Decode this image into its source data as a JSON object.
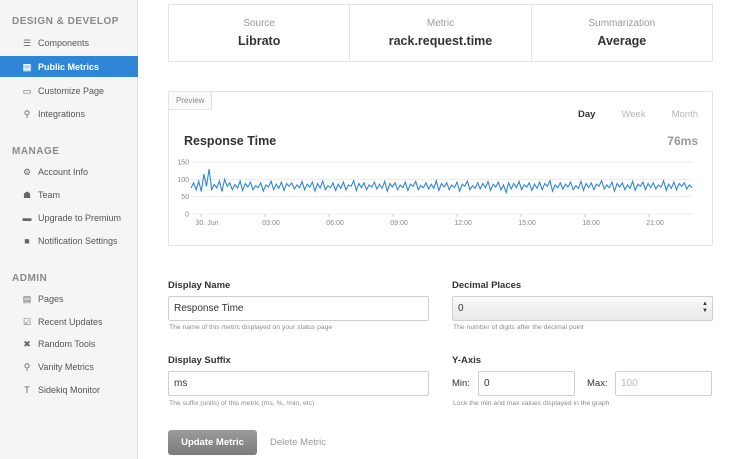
{
  "sidebar": {
    "sections": [
      {
        "title": "DESIGN & DEVELOP",
        "items": [
          {
            "label": "Components",
            "icon": "list-icon",
            "glyph": "☰"
          },
          {
            "label": "Public Metrics",
            "icon": "chart-icon",
            "glyph": "▤",
            "active": true
          },
          {
            "label": "Customize Page",
            "icon": "image-icon",
            "glyph": "▭"
          },
          {
            "label": "Integrations",
            "icon": "plug-icon",
            "glyph": "⚲"
          }
        ]
      },
      {
        "title": "MANAGE",
        "items": [
          {
            "label": "Account Info",
            "icon": "gear-icon",
            "glyph": "⚙"
          },
          {
            "label": "Team",
            "icon": "group-icon",
            "glyph": "☗"
          },
          {
            "label": "Upgrade to Premium",
            "icon": "card-icon",
            "glyph": "▬"
          },
          {
            "label": "Notification Settings",
            "icon": "envelope-icon",
            "glyph": "■"
          }
        ]
      },
      {
        "title": "ADMIN",
        "items": [
          {
            "label": "Pages",
            "icon": "pages-icon",
            "glyph": "▤"
          },
          {
            "label": "Recent Updates",
            "icon": "check-icon",
            "glyph": "☑"
          },
          {
            "label": "Random Tools",
            "icon": "tools-icon",
            "glyph": "✖"
          },
          {
            "label": "Vanity Metrics",
            "icon": "metrics-icon",
            "glyph": "⚲"
          },
          {
            "label": "Sidekiq Monitor",
            "icon": "monitor-icon",
            "glyph": "T"
          }
        ]
      }
    ]
  },
  "summary": {
    "source_label": "Source",
    "source_value": "Librato",
    "metric_label": "Metric",
    "metric_value": "rack.request.time",
    "summarization_label": "Summarization",
    "summarization_value": "Average"
  },
  "preview": {
    "tab_label": "Preview",
    "range_tabs": [
      "Day",
      "Week",
      "Month"
    ],
    "selected_range": "Day",
    "title": "Response Time",
    "current_value": "76ms"
  },
  "chart_data": {
    "type": "line",
    "title": "Response Time",
    "y_ticks": [
      "150",
      "100",
      "50",
      "0"
    ],
    "ylim": [
      0,
      150
    ],
    "x_ticks": [
      "30. Jun",
      "03:00",
      "06:00",
      "09:00",
      "12:00",
      "15:00",
      "18:00",
      "21:00"
    ],
    "series": [
      {
        "color": "#2f86d8",
        "values": [
          75,
          90,
          70,
          95,
          65,
          115,
          80,
          130,
          70,
          85,
          75,
          95,
          65,
          100,
          80,
          90,
          70,
          85,
          75,
          95,
          68,
          88,
          78,
          92,
          70,
          82,
          76,
          90,
          66,
          84,
          78,
          95,
          70,
          86,
          74,
          92,
          68,
          88,
          80,
          90,
          72,
          84,
          76,
          94,
          70,
          86,
          78,
          92,
          66,
          88,
          75,
          95,
          70,
          82,
          76,
          90,
          68,
          86,
          74,
          92,
          70,
          84,
          80,
          96,
          68,
          88,
          76,
          90,
          70,
          84,
          78,
          92,
          72,
          86,
          74,
          94,
          66,
          88,
          78,
          90,
          70,
          84,
          76,
          92,
          68,
          86,
          80,
          94,
          70,
          82,
          76,
          90,
          72,
          86,
          74,
          96,
          68,
          88,
          78,
          90,
          70,
          84,
          76,
          92,
          66,
          86,
          80,
          95,
          70,
          82,
          74,
          90,
          72,
          88,
          76,
          94,
          68,
          86,
          78,
          92,
          70,
          84,
          62,
          90,
          72,
          88,
          76,
          94,
          70,
          84,
          78,
          90,
          68,
          86,
          74,
          92,
          70,
          88,
          80,
          96,
          66,
          84,
          76,
          90,
          72,
          86,
          78,
          92,
          70,
          82,
          74,
          94,
          68,
          88,
          76,
          90,
          70,
          86,
          80,
          96,
          72,
          84,
          76,
          92,
          66,
          88,
          78,
          90,
          70,
          84,
          74,
          94,
          68,
          86,
          80,
          92,
          70,
          88,
          76,
          90,
          72,
          84,
          78,
          96,
          68,
          86,
          74,
          92,
          70,
          88,
          80,
          90,
          72,
          84,
          76
        ]
      }
    ]
  },
  "form": {
    "display_name_label": "Display Name",
    "display_name_value": "Response Time",
    "display_name_help": "The name of this metric displayed on your status page",
    "decimal_places_label": "Decimal Places",
    "decimal_places_value": "0",
    "decimal_places_help": "The number of digits after the decimal point",
    "display_suffix_label": "Display Suffix",
    "display_suffix_value": "ms",
    "display_suffix_help": "The suffix (units) of this metric (ms, %, /min, etc)",
    "yaxis_label": "Y-Axis",
    "min_label": "Min:",
    "min_value": "0",
    "max_label": "Max:",
    "max_placeholder": "100",
    "yaxis_help": "Lock the min and max values displayed in the graph"
  },
  "actions": {
    "update_label": "Update Metric",
    "delete_label": "Delete Metric"
  },
  "colors": {
    "accent": "#2f86d8",
    "line": "#2f86d8",
    "button": "#8a8a8a"
  }
}
